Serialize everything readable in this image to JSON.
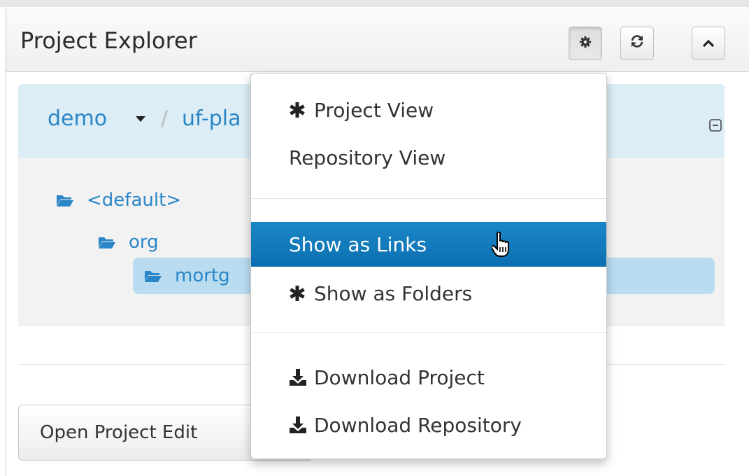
{
  "panel": {
    "title": "Project Explorer",
    "buttons": [
      {
        "name": "settings",
        "icon": "gear-icon"
      },
      {
        "name": "refresh",
        "icon": "refresh-icon"
      },
      {
        "name": "collapse-panel",
        "icon": "chevron-up-icon"
      }
    ]
  },
  "breadcrumb": {
    "organization": "demo",
    "separator": "/",
    "project": "uf-pla"
  },
  "tree": {
    "items": [
      {
        "label": "<default>",
        "icon": "folder-open-icon"
      },
      {
        "label": "org",
        "icon": "folder-open-icon"
      },
      {
        "label": "mortg",
        "icon": "folder-open-icon",
        "selected": true
      }
    ]
  },
  "open_button": {
    "label": "Open Project Edit"
  },
  "menu": {
    "items": [
      {
        "label": "Project View",
        "icon": "asterisk-icon",
        "checked": true
      },
      {
        "label": "Repository View",
        "checked": false
      },
      {
        "label": "Show as Links",
        "highlighted": true
      },
      {
        "label": "Show as Folders",
        "icon": "asterisk-icon",
        "checked": true
      },
      {
        "label": "Download Project",
        "icon": "download-icon"
      },
      {
        "label": "Download Repository",
        "icon": "download-icon"
      }
    ]
  },
  "colors": {
    "link": "#2a86c6",
    "highlight": "#0b6fb0",
    "crumb_bg": "#dcedf6",
    "selected_bg": "#b9dcf0"
  }
}
